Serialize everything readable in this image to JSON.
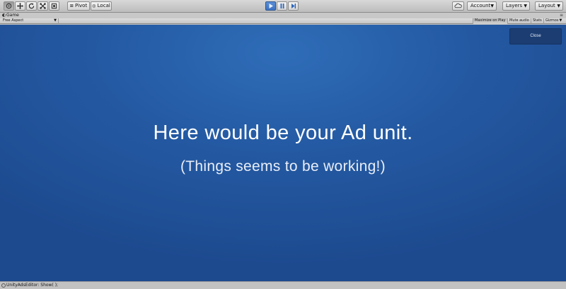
{
  "toolbar": {
    "tools": [
      {
        "name": "hand-tool",
        "icon": "hand-icon"
      },
      {
        "name": "move-tool",
        "icon": "move-icon"
      },
      {
        "name": "rotate-tool",
        "icon": "rotate-icon"
      },
      {
        "name": "scale-tool",
        "icon": "scale-icon"
      },
      {
        "name": "rect-tool",
        "icon": "rect-icon"
      }
    ],
    "pivot_label": "Pivot",
    "local_label": "Local",
    "play": {
      "icon": "play-icon",
      "active": true
    },
    "pause": {
      "icon": "pause-icon"
    },
    "step": {
      "icon": "step-icon"
    },
    "cloud": {
      "icon": "cloud-icon"
    },
    "account_label": "Account",
    "layers_label": "Layers",
    "layout_label": "Layout"
  },
  "game_window": {
    "tab_label": "Game",
    "aspect_label": "Free Aspect",
    "maximize_label": "Maximize on Play",
    "mute_label": "Mute audio",
    "stats_label": "Stats",
    "gizmos_label": "Gizmos"
  },
  "ad": {
    "close_label": "Close",
    "title": "Here would be your Ad unit.",
    "subtitle": "(Things seems to be working!)"
  },
  "status": {
    "message": "UnityAdsEditor: Show( );"
  },
  "colors": {
    "ad_background": "#245aa3",
    "close_button": "#1b3d72",
    "play_active": "#3f72c2"
  }
}
